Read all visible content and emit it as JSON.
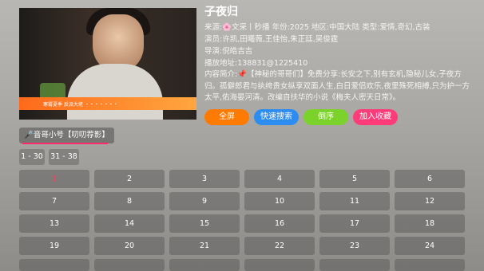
{
  "title": "子夜归",
  "meta": {
    "source_label": "来源:",
    "source_value": "🌸文采丨秒播",
    "year_label": "年份:",
    "year_value": "2025",
    "region_label": "地区:",
    "region_value": "中国大陆",
    "type_label": "类型:",
    "type_value": "爱情,奇幻,古装",
    "cast_label": "演员:",
    "cast_value": "许凯,田曦薇,王佳怡,朱正廷,吴俊霆",
    "director_label": "导演:",
    "director_value": "倪皓吉吉",
    "url_label": "播放地址:",
    "url_value": "138831@1225410"
  },
  "description_label": "内容简介:",
  "description": "📌【神秘的哥哥们】免费分享:长安之下,别有玄机,隐秘儿女,子夜方归。孤僻郎君与纨绔贵女纵享双面人生,白日爱侣欢乐,夜里殊死相搏,只为护一方太平,佑海晏河清。改编自扶华的小说《梅夫人密天日常》。",
  "poster": {
    "banner_text": "寒雾夏季  反派大佬  ・・・・・・・"
  },
  "buttons": {
    "fullscreen": "全屏",
    "quick_search": "快速搜索",
    "order": "倒序",
    "favorite": "加入收藏"
  },
  "colors": {
    "fullscreen": "#ff7a00",
    "quick_search": "#2d8cf0",
    "order": "#7bd22a",
    "favorite": "#ff3b79"
  },
  "source_tab": "🎤音哥小号【叨叨荐影】",
  "ranges": [
    "1 - 30",
    "31 - 38"
  ],
  "episodes": [
    "1",
    "2",
    "3",
    "4",
    "5",
    "6",
    "7",
    "8",
    "9",
    "10",
    "11",
    "12",
    "13",
    "14",
    "15",
    "16",
    "17",
    "18",
    "19",
    "20",
    "21",
    "22",
    "23",
    "24"
  ],
  "active_episode": "1"
}
